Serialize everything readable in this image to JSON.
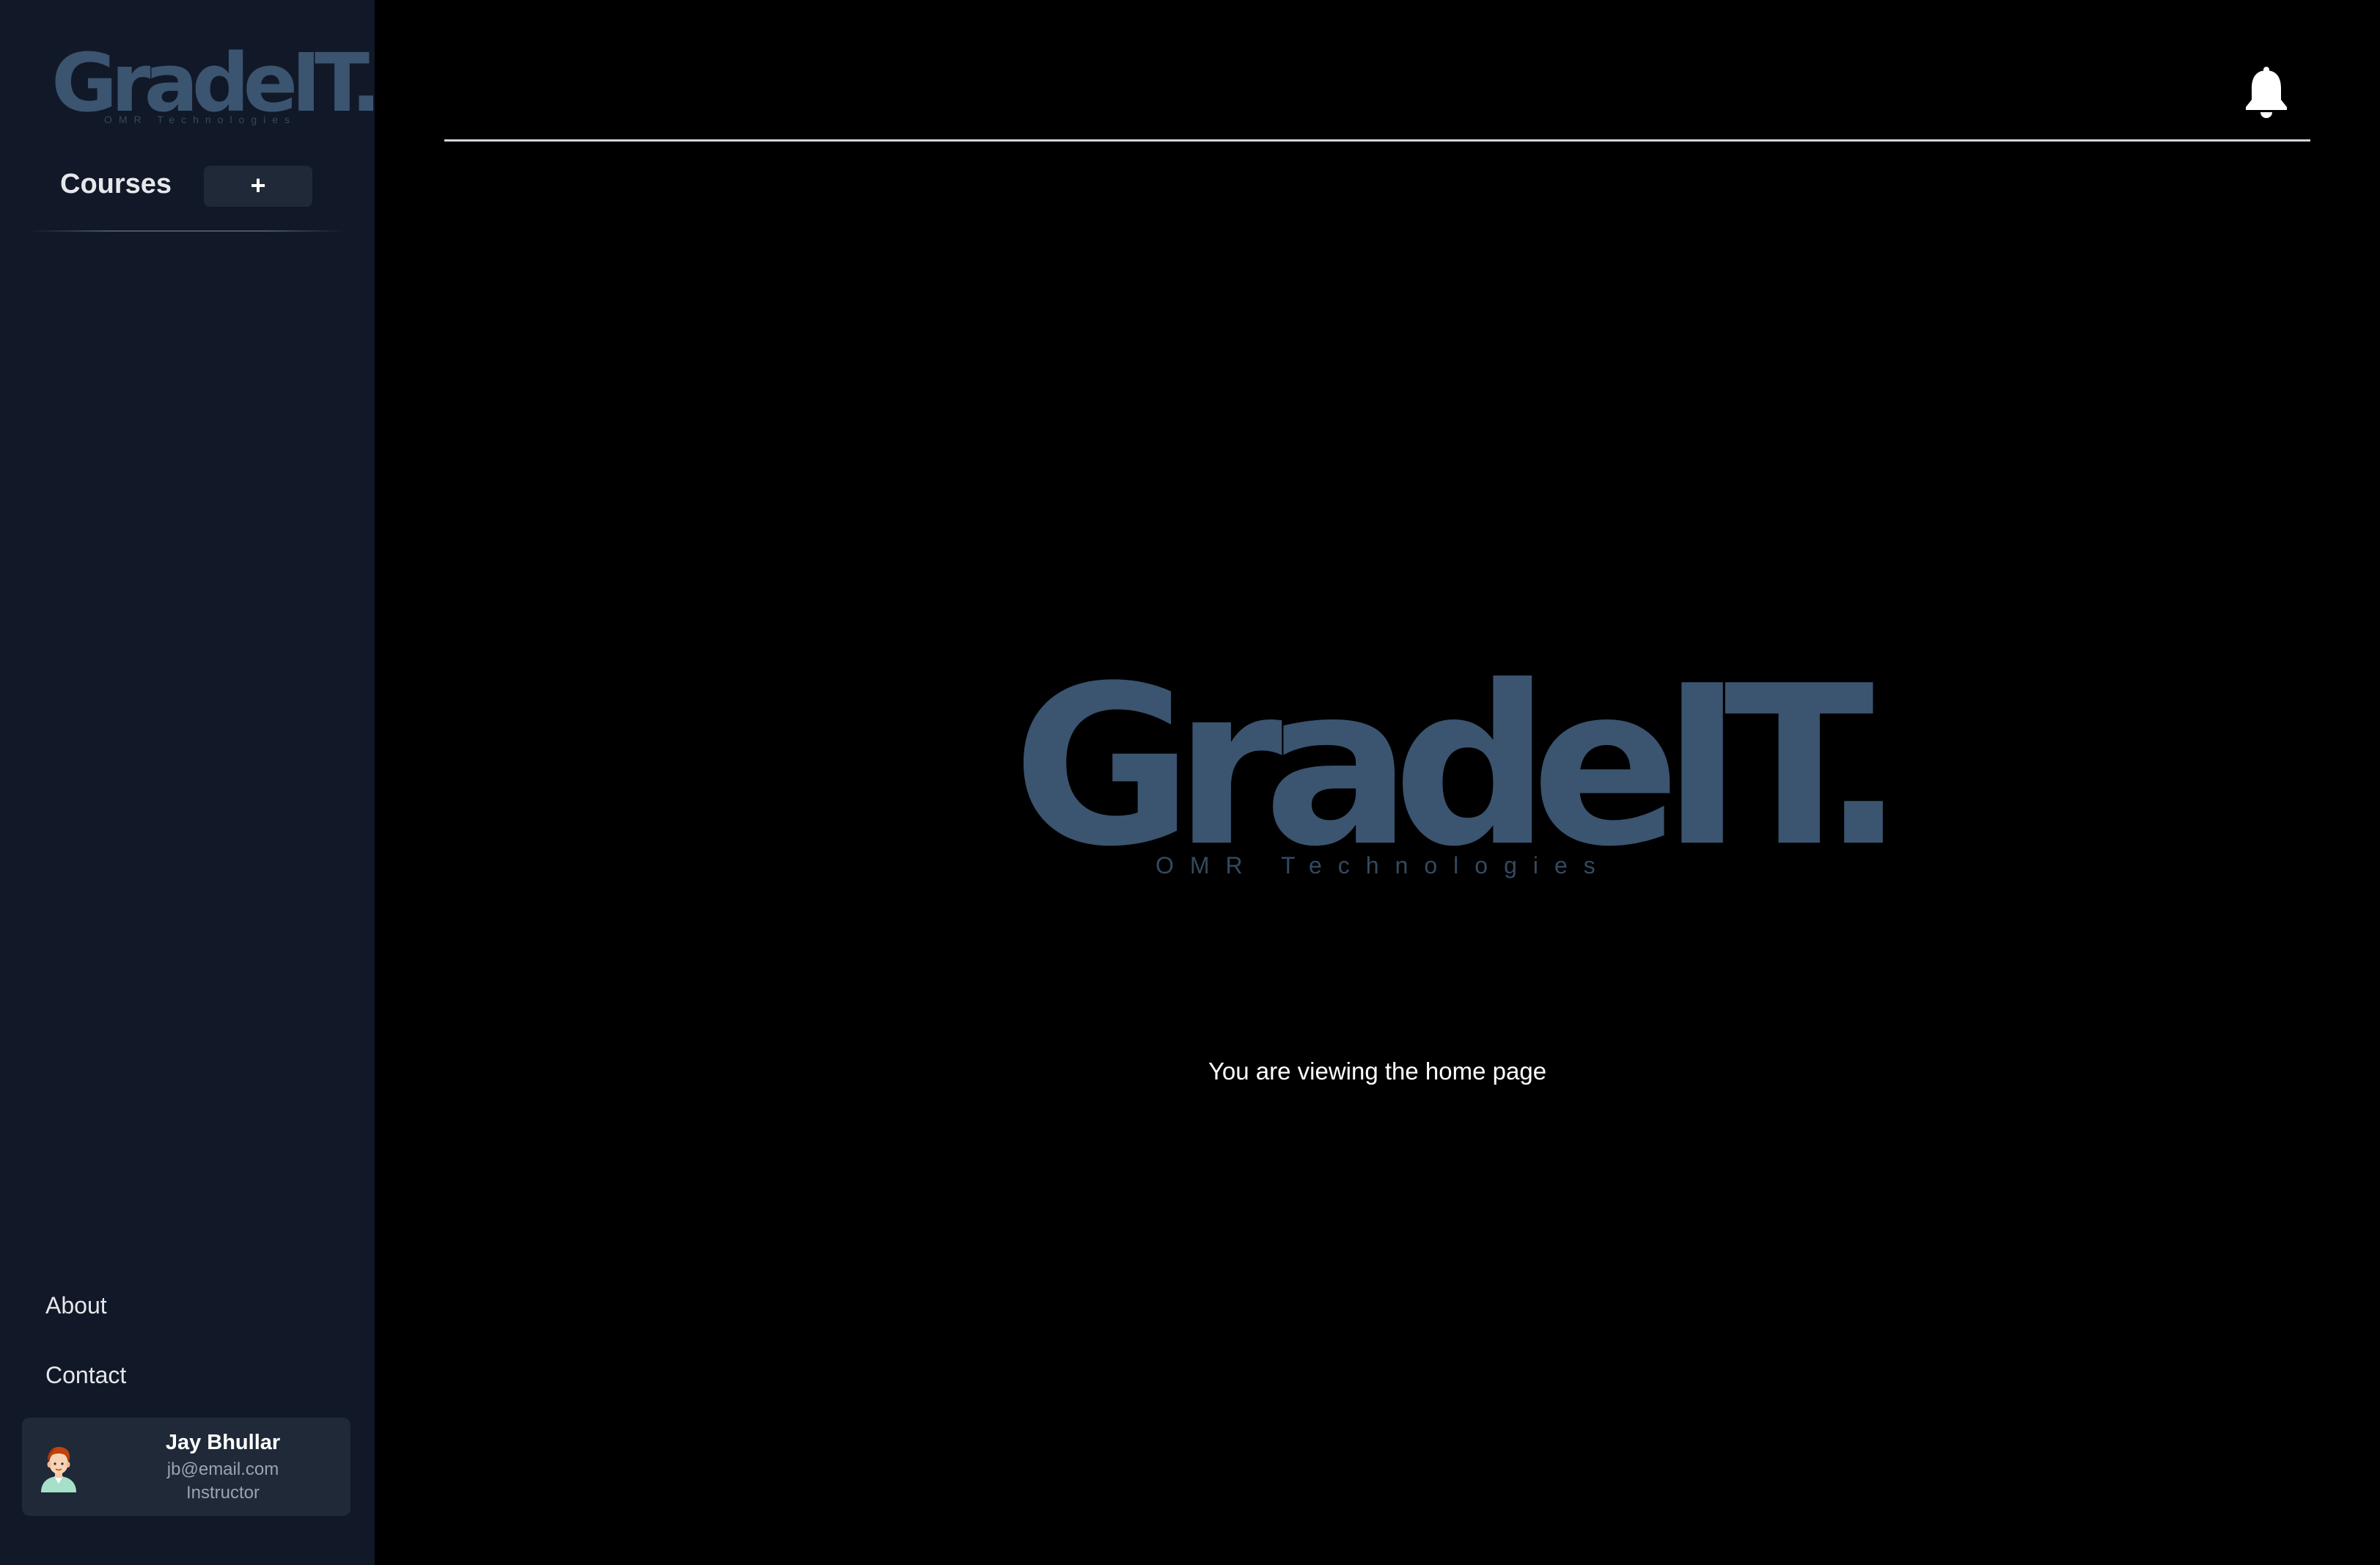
{
  "sidebar": {
    "logo": {
      "wordmark": "GradeIT.",
      "tagline": "OMR Technologies"
    },
    "courses_label": "Courses",
    "add_course_label": "+",
    "nav": {
      "about": "About",
      "contact": "Contact"
    },
    "user": {
      "name": "Jay Bhullar",
      "email": "jb@email.com",
      "role": "Instructor"
    }
  },
  "header": {
    "notification_icon": "bell-icon"
  },
  "main": {
    "logo": {
      "wordmark": "GradeIT.",
      "tagline": "OMR Technologies"
    },
    "message": "You are viewing the home page"
  },
  "colors": {
    "sidebar_bg": "#111827",
    "main_bg": "#000000",
    "card_bg": "#1f2937",
    "logo": "#3b5470"
  }
}
